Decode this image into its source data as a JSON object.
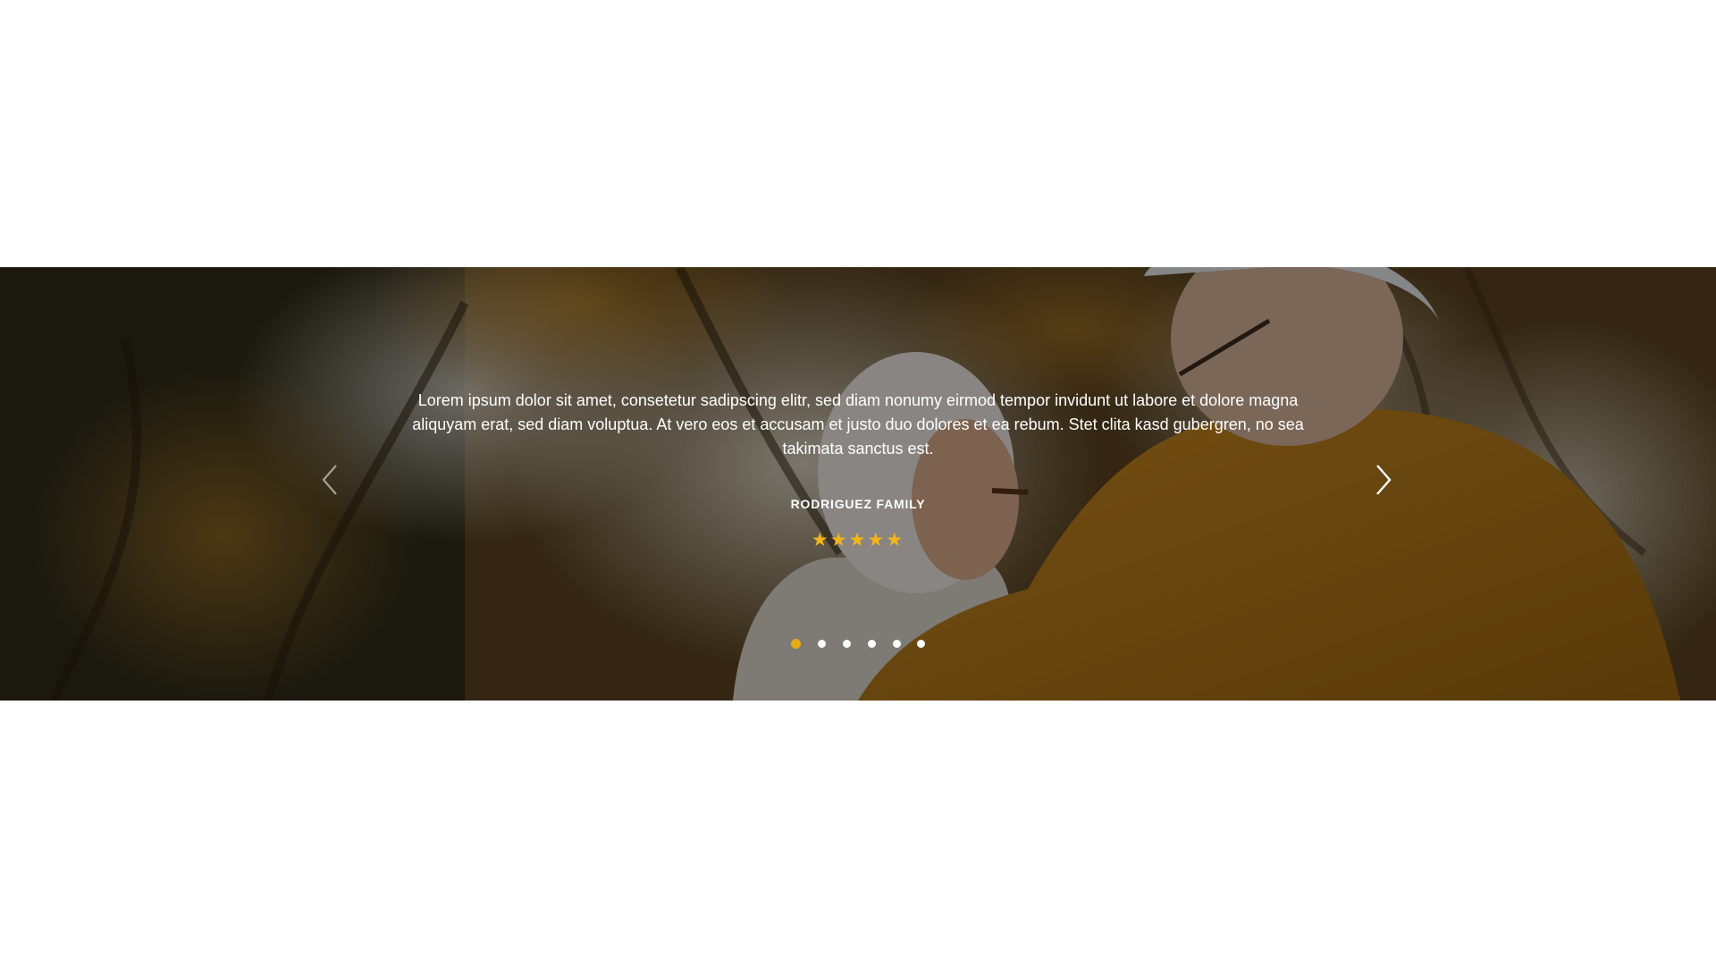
{
  "testimonial": {
    "quote": "Lorem ipsum dolor sit amet, consetetur sadipscing elitr, sed diam nonumy eirmod tempor invidunt ut labore et dolore magna aliquyam erat, sed diam voluptua. At vero eos et accusam et justo duo dolores et ea rebum. Stet clita kasd gubergren, no sea takimata sanctus est.",
    "author": "RODRIGUEZ FAMILY",
    "rating": 5,
    "stars": "★★★★★",
    "star_color": "#f4b41a"
  },
  "carousel": {
    "slide_count": 6,
    "active_index": 0,
    "active_dot_color": "#e8a917",
    "prev_icon": "chevron-left-icon",
    "next_icon": "chevron-right-icon"
  },
  "background": {
    "description_icon": "photo-elderly-couple-autumn"
  }
}
